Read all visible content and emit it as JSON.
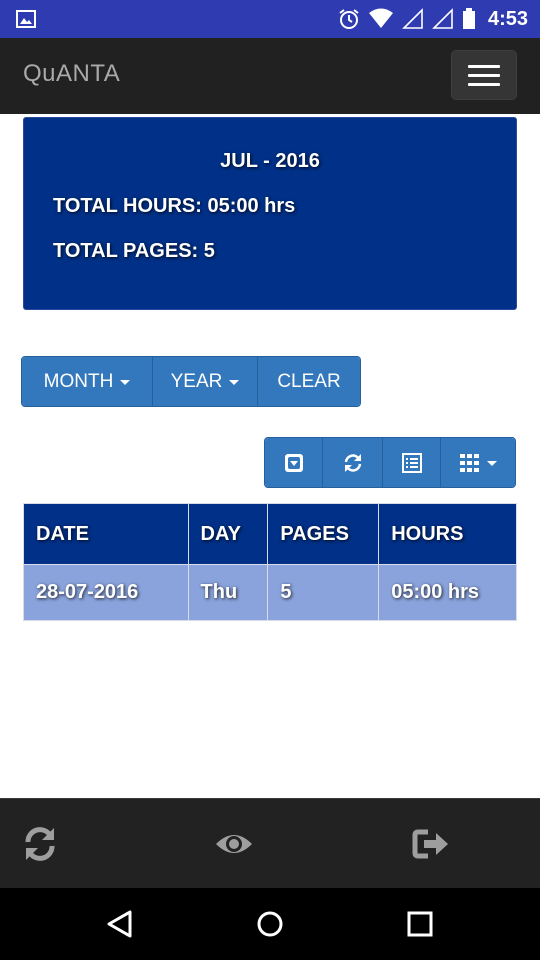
{
  "status_bar": {
    "time": "4:53",
    "icons": [
      "image-notification-icon",
      "alarm-icon",
      "wifi-icon",
      "signal-icon",
      "signal-icon",
      "battery-icon"
    ]
  },
  "app": {
    "brand": "QuANTA",
    "menu_icon": "hamburger-icon"
  },
  "summary": {
    "period": "JUL - 2016",
    "total_hours": "TOTAL HOURS: 05:00 hrs",
    "total_pages": "TOTAL PAGES: 5"
  },
  "filters": {
    "month_label": "MONTH",
    "year_label": "YEAR",
    "clear_label": "CLEAR"
  },
  "toolbar": {
    "buttons": [
      "toggle-view-icon",
      "refresh-icon",
      "list-view-icon",
      "columns-grid-icon"
    ]
  },
  "table": {
    "headers": [
      "DATE",
      "DAY",
      "PAGES",
      "HOURS"
    ],
    "rows": [
      [
        "28-07-2016",
        "Thu",
        "5",
        "05:00 hrs"
      ]
    ]
  },
  "bottom_bar": {
    "icons": [
      "sync-icon",
      "eye-icon",
      "logout-icon"
    ]
  },
  "nav_bar": {
    "icons": [
      "back-icon",
      "home-icon",
      "recents-icon"
    ]
  },
  "colors": {
    "status_bar": "#2f3bb0",
    "app_bar": "#212121",
    "panel": "#003087",
    "button": "#3378bd",
    "row": "#8aa3dc"
  }
}
